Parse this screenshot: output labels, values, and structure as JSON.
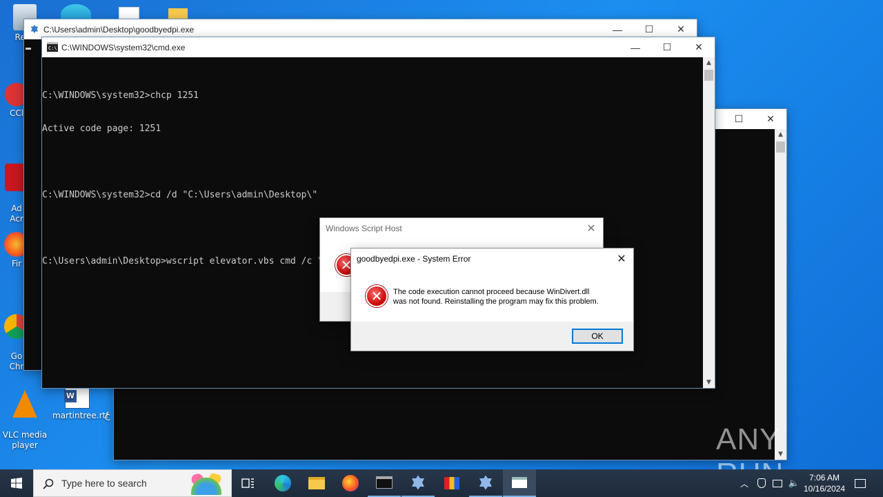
{
  "desktop": {
    "icons": [
      {
        "label": "Recy"
      },
      {
        "label": "CCl"
      },
      {
        "label": "Ad\nAcr"
      },
      {
        "label": "Fir"
      },
      {
        "label": "Go\nChr"
      },
      {
        "label": "VLC media\nplayer"
      },
      {
        "label": "martintree.rtf"
      },
      {
        "label": "C"
      }
    ]
  },
  "windows": {
    "goodbye": {
      "title": "C:\\Users\\admin\\Desktop\\goodbyedpi.exe"
    },
    "cmd": {
      "title": "C:\\WINDOWS\\system32\\cmd.exe",
      "lines": [
        "C:\\WINDOWS\\system32>chcp 1251",
        "Active code page: 1251",
        "",
        "C:\\WINDOWS\\system32>cd /d \"C:\\Users\\admin\\Desktop\\\"",
        "",
        "C:\\Users\\admin\\Desktop>wscript elevator.vbs cmd /c \"C:\\Users\\admin\\Desktop\\Config.cmd\""
      ]
    }
  },
  "dialogs": {
    "wsh": {
      "title": "Windows Script Host"
    },
    "syserr": {
      "title": "goodbyedpi.exe - System Error",
      "message_line1": "The code execution cannot proceed because WinDivert.dll",
      "message_line2": "was not found. Reinstalling the program may fix this problem.",
      "ok_label": "OK"
    }
  },
  "watermark": {
    "text": "ANY RUN"
  },
  "taskbar": {
    "search_placeholder": "Type here to search",
    "time": "7:06 AM",
    "date": "10/16/2024"
  },
  "colors": {
    "desktop": "#1a6fd1",
    "console_bg": "#0c0c0c",
    "console_fg": "#cccccc",
    "taskbar": "#1e2b3b",
    "error_red": "#c40000",
    "accent": "#0078d7"
  }
}
